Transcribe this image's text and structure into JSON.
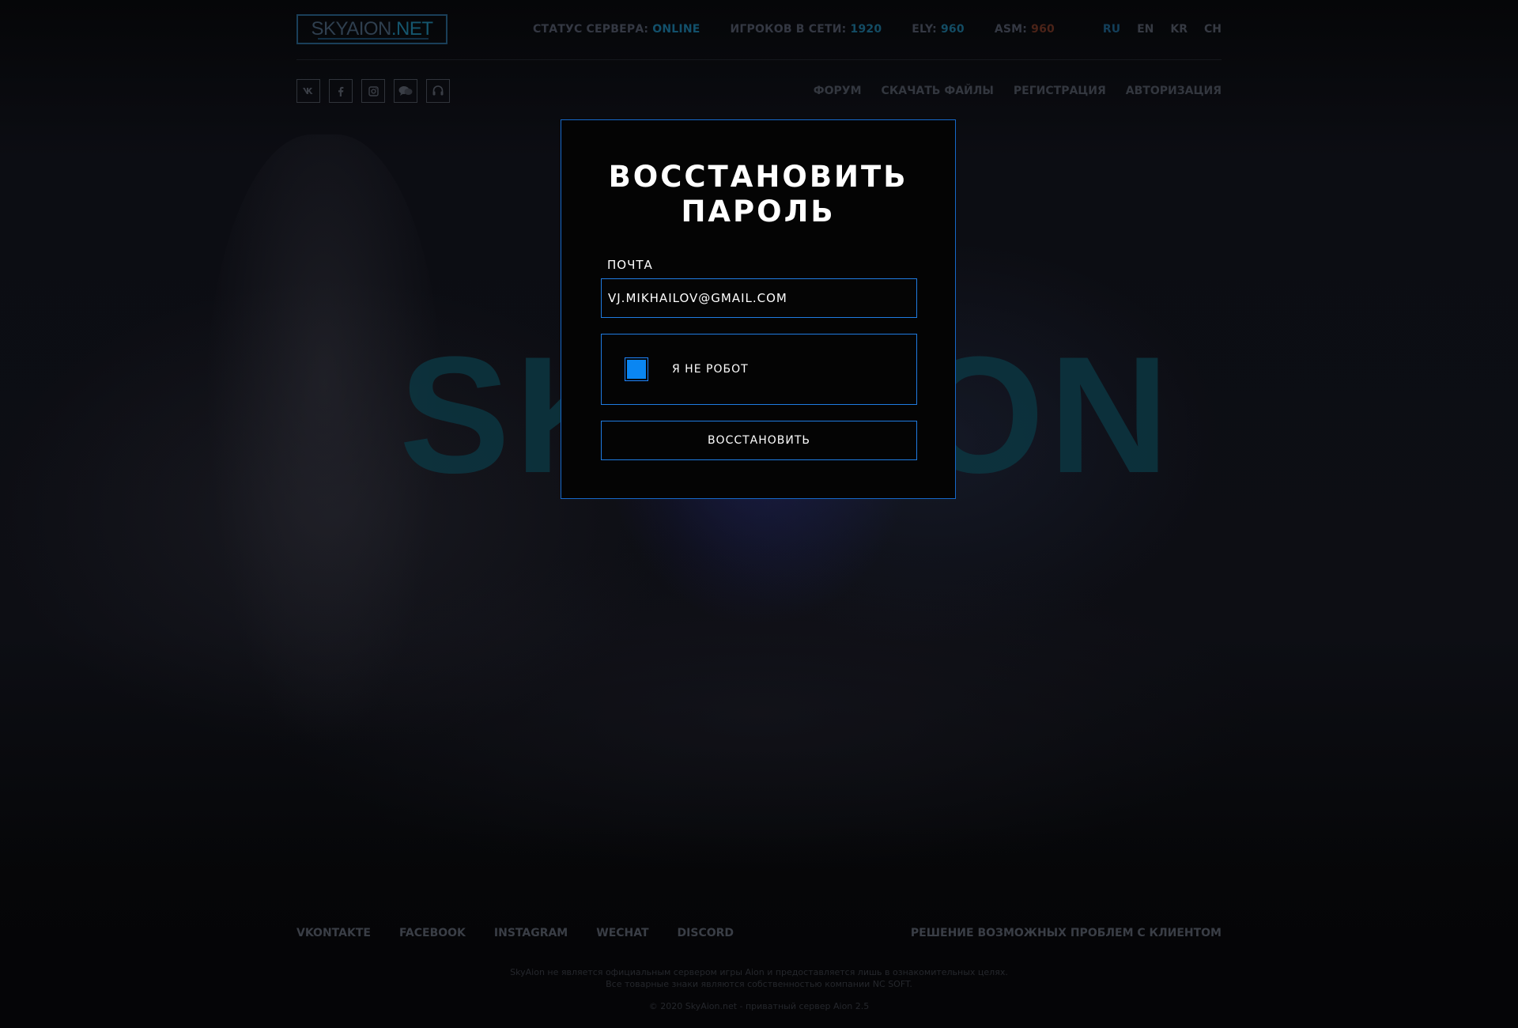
{
  "header": {
    "logo": {
      "part1": "SKYAION",
      "part2": ".NET"
    },
    "stats": [
      {
        "label": "СТАТУС СЕРВЕРА:",
        "value": "ONLINE"
      },
      {
        "label": "ИГРОКОВ В СЕТИ:",
        "value": "1920"
      },
      {
        "label": "ELY:",
        "value": "960"
      },
      {
        "label": "ASM:",
        "value": "960"
      }
    ],
    "languages": [
      "RU",
      "EN",
      "KR",
      "CH"
    ],
    "active_language": "RU",
    "social_icons": [
      "vk-icon",
      "facebook-icon",
      "instagram-icon",
      "wechat-icon",
      "discord-headset-icon"
    ],
    "nav": [
      "ФОРУМ",
      "СКАЧАТЬ ФАЙЛЫ",
      "РЕГИСТРАЦИЯ",
      "АВТОРИЗАЦИЯ"
    ]
  },
  "background": {
    "wordmark": "SKYAION"
  },
  "modal": {
    "title_line1": "ВОССТАНОВИТЬ",
    "title_line2": "ПАРОЛЬ",
    "email_label": "ПОЧТА",
    "email_value": "VJ.MIKHAILOV@GMAIL.COM",
    "captcha_label": "Я НЕ РОБОТ",
    "captcha_checked": true,
    "submit_label": "ВОССТАНОВИТЬ"
  },
  "footer": {
    "links": [
      "VKONTAKTE",
      "FACEBOOK",
      "INSTAGRAM",
      "WECHAT",
      "DISCORD"
    ],
    "help_link": "РЕШЕНИЕ ВОЗМОЖНЫХ ПРОБЛЕМ С КЛИЕНТОМ",
    "disclaimer_line1": "SkyAion не является официальным сервером игры Aion и предоставляется лишь в ознакомительных целях.",
    "disclaimer_line2": "Все товарные знаки являются собственностью компании NC SOFT.",
    "copyright": "© 2020 SkyAion.net - приватный сервер Aion 2.5"
  },
  "colors": {
    "accent_blue": "#1f7be0",
    "checkbox_fill": "#0a86f2",
    "modal_background": "#040404"
  }
}
